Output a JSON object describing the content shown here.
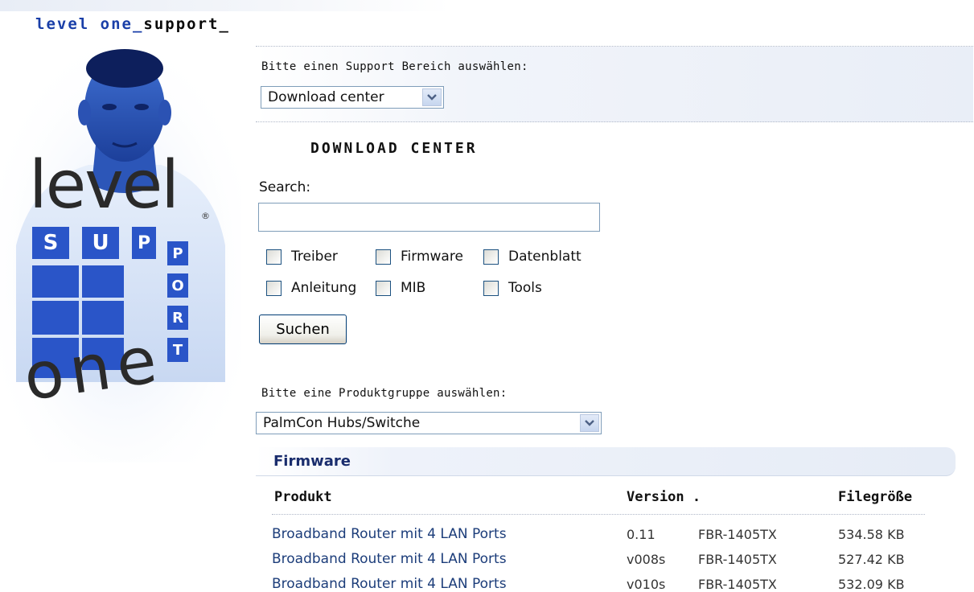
{
  "header": {
    "brand_part1": "level one_",
    "brand_part2": "support_"
  },
  "logo": {
    "word_top": "level",
    "tiles": [
      "S",
      "U",
      "P",
      "P",
      "O",
      "R",
      "T"
    ],
    "word_bottom": "one",
    "reg_mark": "®",
    "accent_color": "#2a55c8"
  },
  "support_area": {
    "label": "Bitte einen Support Bereich auswählen:",
    "selected": "Download center"
  },
  "download_center": {
    "title": "DOWNLOAD CENTER",
    "search_label": "Search:",
    "search_value": "",
    "checkboxes": [
      "Treiber",
      "Firmware",
      "Datenblatt",
      "Anleitung",
      "MIB",
      "Tools"
    ],
    "search_button": "Suchen"
  },
  "product_group": {
    "label": "Bitte eine Produktgruppe auswählen:",
    "selected": "PalmCon Hubs/Switche"
  },
  "results": {
    "group_title": "Firmware",
    "columns": [
      "Produkt",
      "Version .",
      "Filegröße"
    ],
    "rows": [
      {
        "product": "Broadband Router mit 4 LAN Ports",
        "version": "0.11",
        "model": "FBR-1405TX",
        "size": "534.58 KB"
      },
      {
        "product": "Broadband Router mit 4 LAN Ports",
        "version": "v008s",
        "model": "FBR-1405TX",
        "size": "527.42 KB"
      },
      {
        "product": "Broadband Router mit 4 LAN Ports",
        "version": "v010s",
        "model": "FBR-1405TX",
        "size": "532.09 KB"
      }
    ]
  }
}
